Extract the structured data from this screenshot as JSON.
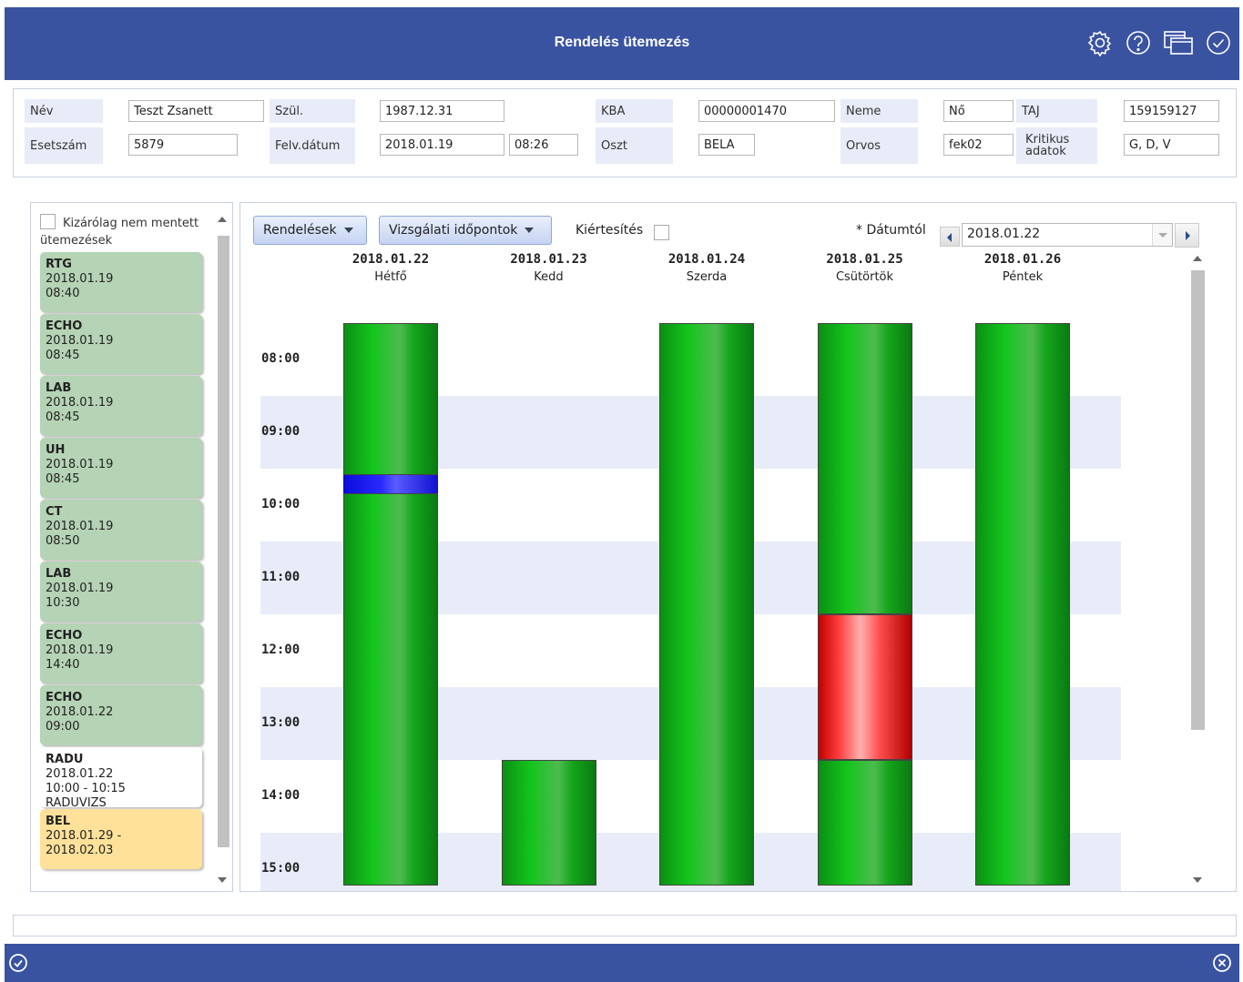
{
  "window": {
    "title": "Rendelés ütemezés"
  },
  "patient": {
    "nev_label": "Név",
    "nev": "Teszt Zsanett",
    "szul_label": "Szül.",
    "szul": "1987.12.31",
    "kba_label": "KBA",
    "kba": "00000001470",
    "neme_label": "Neme",
    "neme": "Nő",
    "taj_label": "TAJ",
    "taj": "159159127",
    "esetszam_label": "Esetszám",
    "esetszam": "5879",
    "felv_label": "Felv.dátum",
    "felv_datum": "2018.01.19",
    "felv_ido": "08:26",
    "oszt_label": "Oszt",
    "oszt": "BELA",
    "orvos_label": "Orvos",
    "orvos": "fek02",
    "kritikus_label": "Kritikus adatok",
    "kritikus": "G, D, V"
  },
  "left": {
    "filter_label": "Kizárólag nem mentett ütemezések",
    "items": [
      {
        "name": "RTG",
        "line1": "2018.01.19",
        "line2": "08:40",
        "line3": "",
        "state": "saved"
      },
      {
        "name": "ECHO",
        "line1": "2018.01.19",
        "line2": "08:45",
        "line3": "",
        "state": "saved"
      },
      {
        "name": "LAB",
        "line1": "2018.01.19",
        "line2": "08:45",
        "line3": "",
        "state": "saved"
      },
      {
        "name": "UH",
        "line1": "2018.01.19",
        "line2": "08:45",
        "line3": "",
        "state": "saved"
      },
      {
        "name": "CT",
        "line1": "2018.01.19",
        "line2": "08:50",
        "line3": "",
        "state": "saved"
      },
      {
        "name": "LAB",
        "line1": "2018.01.19",
        "line2": "10:30",
        "line3": "",
        "state": "saved"
      },
      {
        "name": "ECHO",
        "line1": "2018.01.19",
        "line2": "14:40",
        "line3": "",
        "state": "saved"
      },
      {
        "name": "ECHO",
        "line1": "2018.01.22",
        "line2": "09:00",
        "line3": "",
        "state": "saved"
      },
      {
        "name": "RADU",
        "line1": "2018.01.22",
        "line2": "10:00 - 10:15",
        "line3": "RADUVIZS",
        "state": "unsaved"
      },
      {
        "name": "BEL",
        "line1": "2018.01.29 -",
        "line2": "2018.02.03",
        "line3": "",
        "state": "pending"
      }
    ]
  },
  "toolbar": {
    "rendelesek": "Rendelések",
    "vizsgalati": "Vizsgálati időpontok",
    "kiertesites": "Kiértesítés",
    "datumtol_label": "* Dátumtól",
    "datumtol": "2018.01.22"
  },
  "days": [
    {
      "date": "2018.01.22",
      "name": "Hétfő"
    },
    {
      "date": "2018.01.23",
      "name": "Kedd"
    },
    {
      "date": "2018.01.24",
      "name": "Szerda"
    },
    {
      "date": "2018.01.25",
      "name": "Csütörtök"
    },
    {
      "date": "2018.01.26",
      "name": "Péntek"
    }
  ],
  "hours": [
    "08:00",
    "09:00",
    "10:00",
    "11:00",
    "12:00",
    "13:00",
    "14:00",
    "15:00"
  ],
  "colors": {
    "header": "#3a53a1",
    "saved": "#b5d3b5",
    "unsaved": "#ffffff",
    "pending": "#ffe199",
    "available": "#13c51c",
    "booked": "#ff3e3e",
    "selected": "#2a2aff"
  },
  "availability": [
    {
      "day": "2018.01.22",
      "blocks": [
        {
          "from": "07:30",
          "to": "09:35",
          "status": "available"
        },
        {
          "from": "09:35",
          "to": "09:50",
          "status": "selected"
        },
        {
          "from": "09:50",
          "to": "15:30",
          "status": "available"
        }
      ]
    },
    {
      "day": "2018.01.23",
      "blocks": [
        {
          "from": "13:30",
          "to": "15:30",
          "status": "available"
        }
      ]
    },
    {
      "day": "2018.01.24",
      "blocks": [
        {
          "from": "07:30",
          "to": "15:30",
          "status": "available"
        }
      ]
    },
    {
      "day": "2018.01.25",
      "blocks": [
        {
          "from": "07:30",
          "to": "11:30",
          "status": "available"
        },
        {
          "from": "11:30",
          "to": "13:30",
          "status": "booked"
        },
        {
          "from": "13:30",
          "to": "15:30",
          "status": "available"
        }
      ]
    },
    {
      "day": "2018.01.26",
      "blocks": [
        {
          "from": "07:30",
          "to": "15:30",
          "status": "available"
        }
      ]
    }
  ]
}
